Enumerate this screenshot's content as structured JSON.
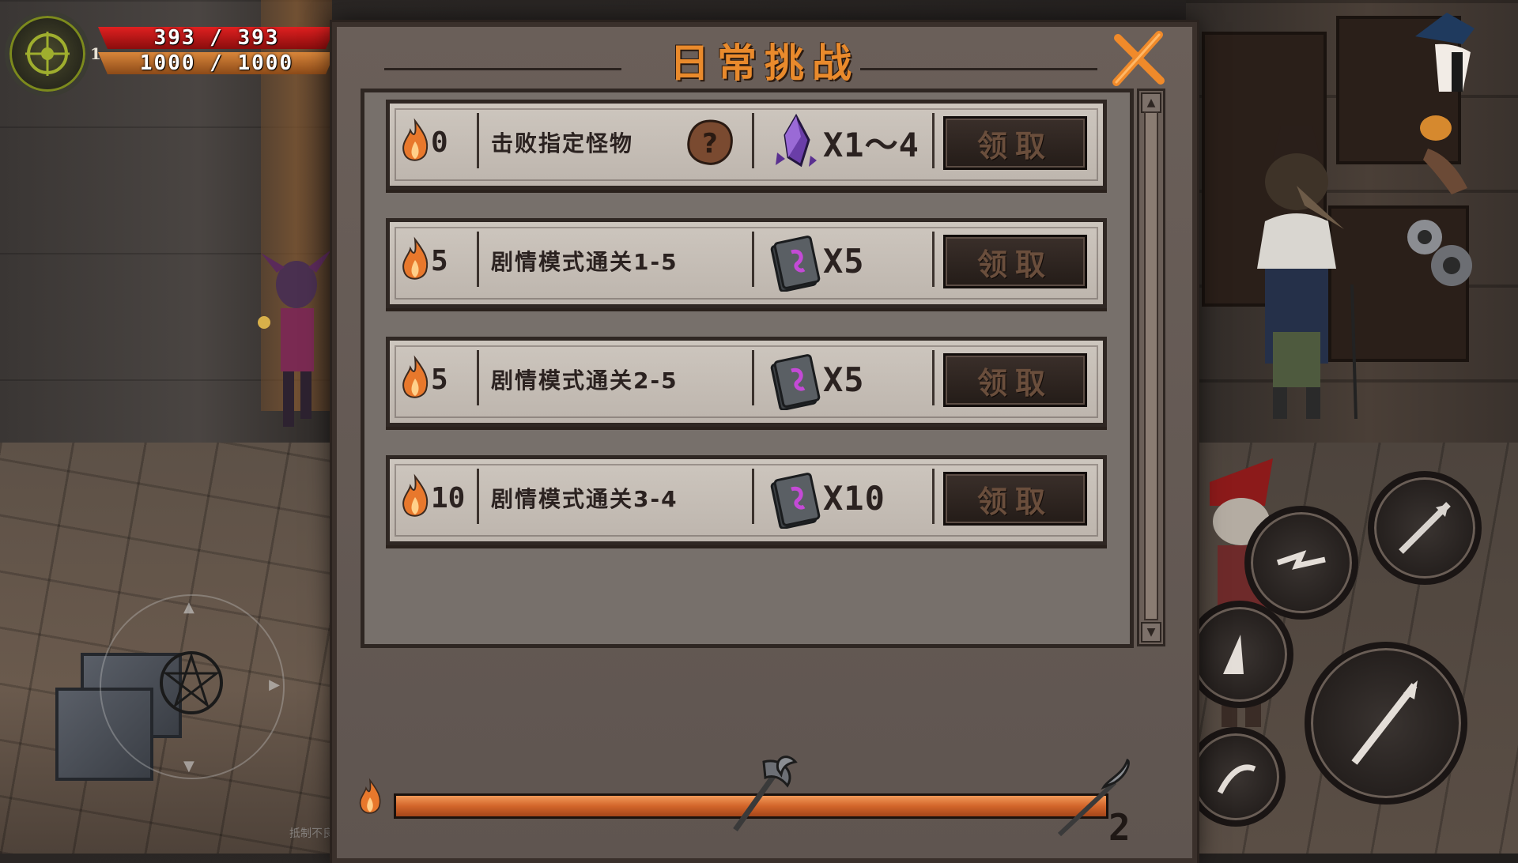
{
  "hud": {
    "level": "1",
    "hp_text": "393 / 393",
    "mp_text": "1000 / 1000",
    "colors": {
      "hp": "#d81b1b",
      "mp": "#c4742e",
      "emblem_ring": "#7c8a1d"
    }
  },
  "panel": {
    "title": "日常挑战",
    "close_icon": "close-x-icon",
    "colors": {
      "title": "#e98a2c",
      "close": "#f08a2a"
    }
  },
  "tasks": [
    {
      "points": "0",
      "description": "击败指定怪物",
      "has_unknown_target": true,
      "reward_icon": "purple-crystal-icon",
      "reward_qty": "X1～4",
      "button_label": "领取"
    },
    {
      "points": "5",
      "description": "剧情模式通关1-5",
      "has_unknown_target": false,
      "reward_icon": "spell-card-icon",
      "reward_qty": "X5",
      "button_label": "领取"
    },
    {
      "points": "5",
      "description": "剧情模式通关2-5",
      "has_unknown_target": false,
      "reward_icon": "spell-card-icon",
      "reward_qty": "X5",
      "button_label": "领取"
    },
    {
      "points": "10",
      "description": "剧情模式通关3-4",
      "has_unknown_target": false,
      "reward_icon": "spell-card-icon",
      "reward_qty": "X10",
      "button_label": "领取"
    }
  ],
  "progress": {
    "fraction": 1.0,
    "count": "2",
    "milestone_icons": [
      "axe-weapon-icon",
      "scythe-weapon-icon"
    ]
  },
  "background": {
    "faded_label": "抵制不良"
  }
}
